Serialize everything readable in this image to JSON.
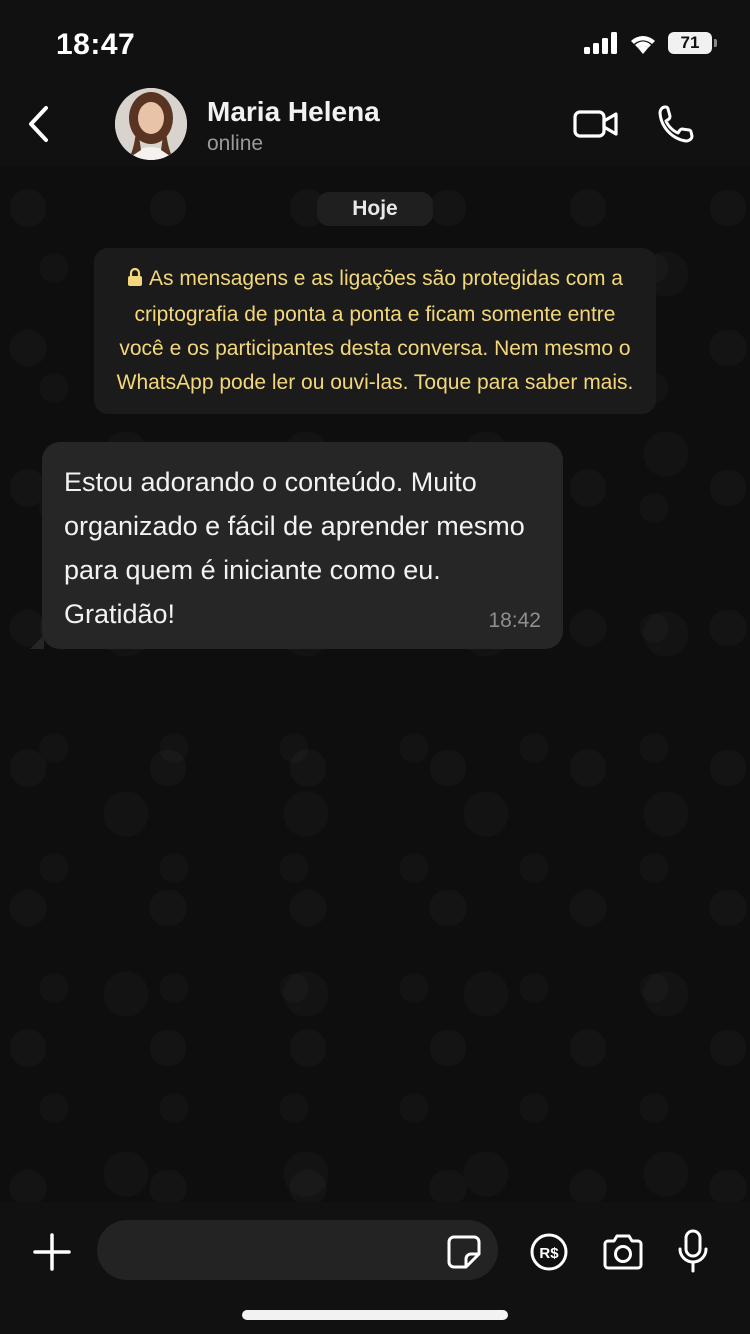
{
  "status_bar": {
    "time": "18:47",
    "battery": "71"
  },
  "header": {
    "contact_name": "Maria Helena",
    "status": "online"
  },
  "chat": {
    "date_label": "Hoje",
    "encryption_notice": "As mensagens e as ligações são protegidas com a criptografia de ponta a ponta e ficam somente entre você e os participantes desta conversa. Nem mesmo o WhatsApp pode ler ou ouvi-las. Toque para saber mais.",
    "messages": [
      {
        "text": "Estou adorando o conteúdo. Muito organizado e fácil de aprender mesmo para quem é iniciante como eu. Gratidão!",
        "time": "18:42"
      }
    ]
  },
  "input_bar": {
    "placeholder": "",
    "value": ""
  },
  "colors": {
    "background": "#0e0e0e",
    "bubble": "#262626",
    "notice_text": "#f3d77a",
    "bar": "#111111"
  },
  "icons": [
    "back-arrow-icon",
    "video-call-icon",
    "phone-icon",
    "lock-icon",
    "plus-icon",
    "sticker-icon",
    "payment-icon",
    "camera-icon",
    "microphone-icon"
  ]
}
